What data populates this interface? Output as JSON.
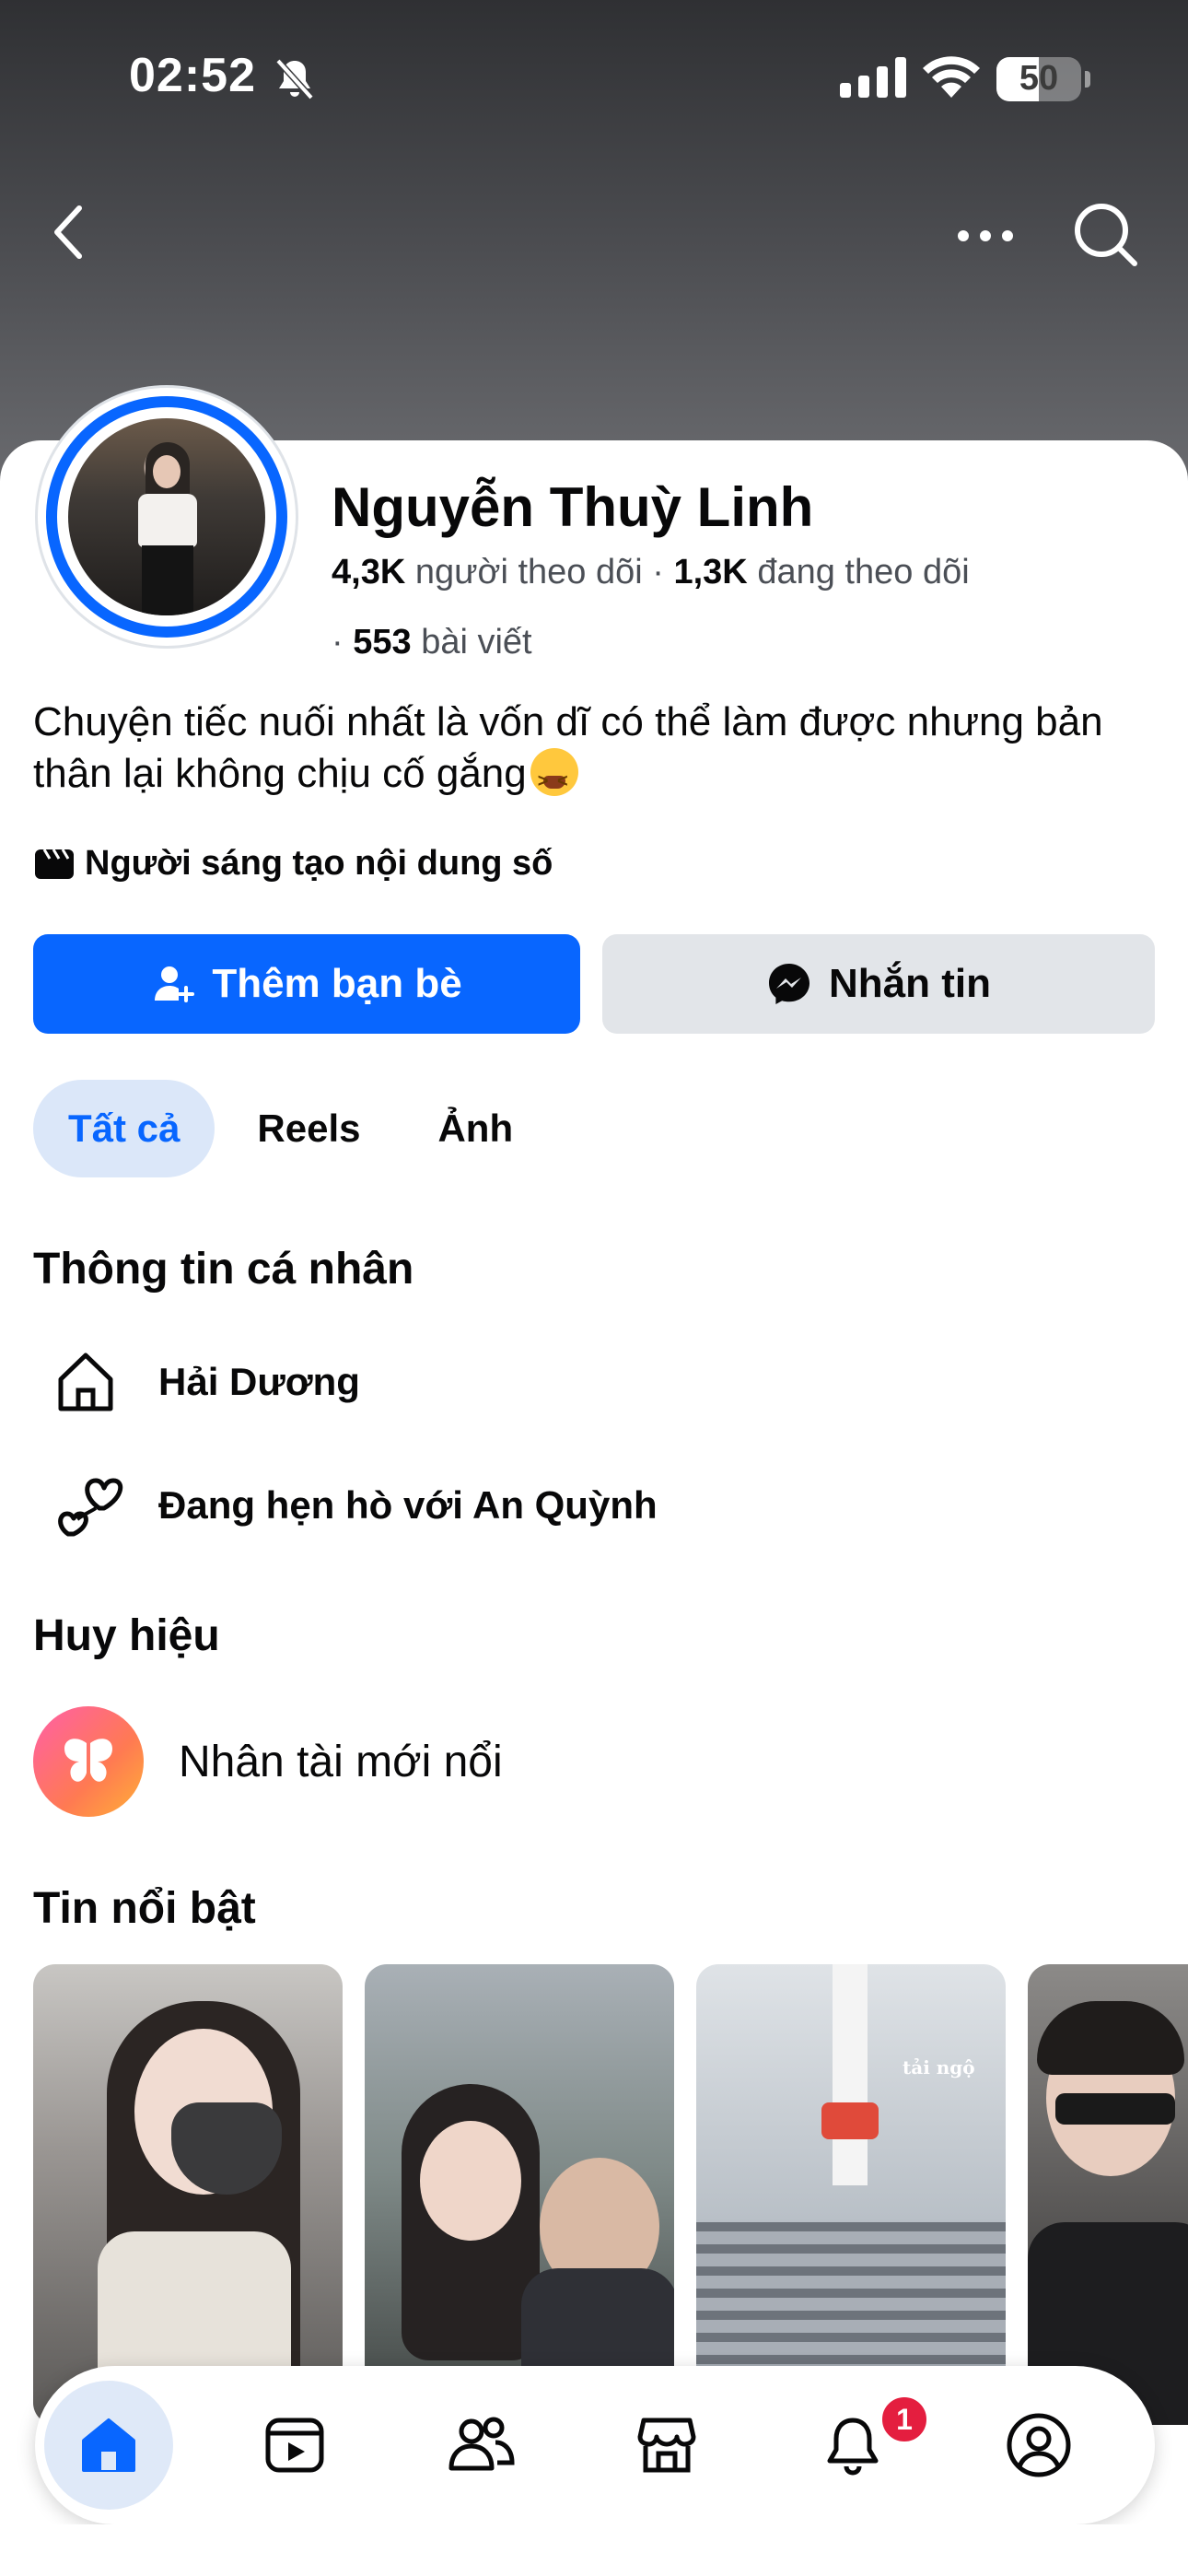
{
  "status_bar": {
    "time": "02:52",
    "battery": "50",
    "battery_level": 0.5
  },
  "profile": {
    "name": "Nguyễn Thuỳ Linh",
    "followers_count": "4,3K",
    "followers_label": "người theo dõi",
    "following_count": "1,3K",
    "following_label": "đang theo dõi",
    "posts_count": "553",
    "posts_label": "bài viết",
    "bio": "Chuyện tiếc nuối nhất là vốn dĩ có thể làm được nhưng bản thân lại không chịu cố gắng",
    "creator_label": "Người sáng tạo nội dung số"
  },
  "actions": {
    "add_friend": "Thêm bạn bè",
    "message": "Nhắn tin"
  },
  "tabs": [
    {
      "label": "Tất cả",
      "active": true
    },
    {
      "label": "Reels",
      "active": false
    },
    {
      "label": "Ảnh",
      "active": false
    }
  ],
  "personal_info": {
    "title": "Thông tin cá nhân",
    "items": [
      {
        "icon": "home-icon",
        "text": "Hải Dương"
      },
      {
        "icon": "hearts-icon",
        "text": "Đang hẹn hò với An Quỳnh"
      }
    ]
  },
  "badges": {
    "title": "Huy hiệu",
    "items": [
      {
        "icon": "butterfly-icon",
        "text": "Nhân tài mới nổi"
      }
    ]
  },
  "highlights": {
    "title": "Tin nổi bật",
    "story3_caption": "tải ngộ"
  },
  "bottom_nav": {
    "items": [
      "home-icon",
      "video-icon",
      "friends-icon",
      "marketplace-icon",
      "notifications-icon",
      "profile-icon"
    ],
    "notification_count": "1"
  },
  "colors": {
    "accent": "#0866ff",
    "badge_red": "#e41e3f",
    "secondary_button": "#e2e5e9"
  }
}
